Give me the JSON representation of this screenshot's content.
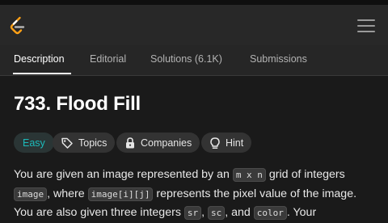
{
  "header": {
    "logo_icon": "leetcode-logo",
    "menu_icon": "hamburger-menu-icon"
  },
  "tabs": [
    {
      "label": "Description",
      "active": true
    },
    {
      "label": "Editorial",
      "active": false
    },
    {
      "label": "Solutions (6.1K)",
      "active": false
    },
    {
      "label": "Submissions",
      "active": false
    }
  ],
  "problem": {
    "title": "733. Flood Fill",
    "difficulty": "Easy",
    "chips": [
      {
        "label": "Topics",
        "icon": "tag-icon"
      },
      {
        "label": "Companies",
        "icon": "lock-icon"
      },
      {
        "label": "Hint",
        "icon": "lightbulb-icon"
      }
    ],
    "description": {
      "t1": "You are given an image represented by an ",
      "c1": "m x n",
      "t2": " grid of integers ",
      "c2": "image",
      "t3": ", where ",
      "c3": "image[i][j]",
      "t4": " represents the pixel value of the image. You are also given three integers ",
      "c4": "sr",
      "t5": ", ",
      "c5": "sc",
      "t6": ", and ",
      "c6": "color",
      "t7": ". Your"
    }
  },
  "colors": {
    "accent_easy": "#1cbaba",
    "background": "#1a1a1a",
    "header": "#282828"
  }
}
